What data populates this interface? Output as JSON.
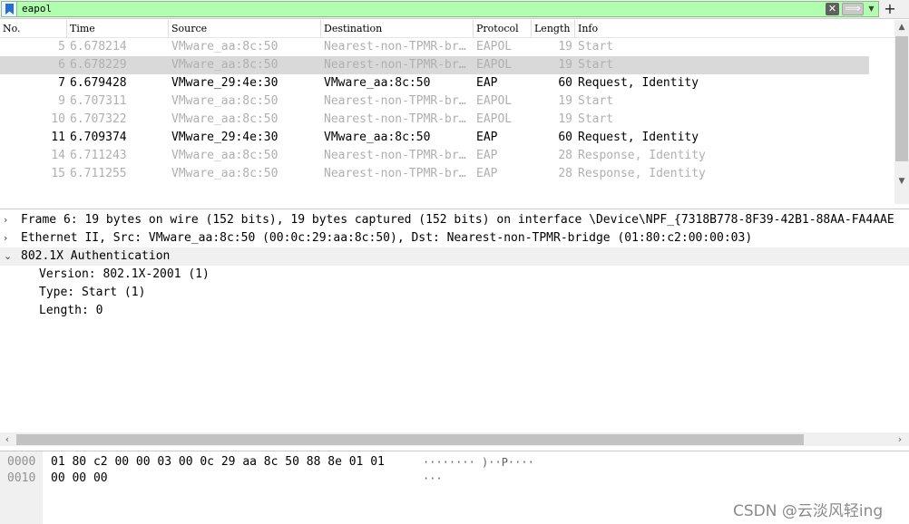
{
  "filter": {
    "value": "eapol",
    "clear_icon": "✕",
    "apply_icon": "⟹",
    "dropdown_icon": "▼",
    "add_icon": "+"
  },
  "packet_list": {
    "columns": [
      "No.",
      "Time",
      "Source",
      "Destination",
      "Protocol",
      "Length",
      "Info"
    ],
    "rows": [
      {
        "no": "5",
        "time": "6.678214",
        "src": "VMware_aa:8c:50",
        "dst": "Nearest-non-TPMR-br…",
        "proto": "EAPOL",
        "len": "19",
        "info": "Start"
      },
      {
        "no": "6",
        "time": "6.678229",
        "src": "VMware_aa:8c:50",
        "dst": "Nearest-non-TPMR-br…",
        "proto": "EAPOL",
        "len": "19",
        "info": "Start"
      },
      {
        "no": "7",
        "time": "6.679428",
        "src": "VMware_29:4e:30",
        "dst": "VMware_aa:8c:50",
        "proto": "EAP",
        "len": "60",
        "info": "Request, Identity"
      },
      {
        "no": "9",
        "time": "6.707311",
        "src": "VMware_aa:8c:50",
        "dst": "Nearest-non-TPMR-br…",
        "proto": "EAPOL",
        "len": "19",
        "info": "Start"
      },
      {
        "no": "10",
        "time": "6.707322",
        "src": "VMware_aa:8c:50",
        "dst": "Nearest-non-TPMR-br…",
        "proto": "EAPOL",
        "len": "19",
        "info": "Start"
      },
      {
        "no": "11",
        "time": "6.709374",
        "src": "VMware_29:4e:30",
        "dst": "VMware_aa:8c:50",
        "proto": "EAP",
        "len": "60",
        "info": "Request, Identity"
      },
      {
        "no": "14",
        "time": "6.711243",
        "src": "VMware_aa:8c:50",
        "dst": "Nearest-non-TPMR-br…",
        "proto": "EAP",
        "len": "28",
        "info": "Response, Identity"
      },
      {
        "no": "15",
        "time": "6.711255",
        "src": "VMware_aa:8c:50",
        "dst": "Nearest-non-TPMR-br…",
        "proto": "EAP",
        "len": "28",
        "info": "Response, Identity"
      }
    ]
  },
  "detail": {
    "frame": "Frame 6: 19 bytes on wire (152 bits), 19 bytes captured (152 bits) on interface \\Device\\NPF_{7318B778-8F39-42B1-88AA-FA4AAE",
    "ethernet": "Ethernet II, Src: VMware_aa:8c:50 (00:0c:29:aa:8c:50), Dst: Nearest-non-TPMR-bridge (01:80:c2:00:00:03)",
    "auth": "802.1X Authentication",
    "version": "Version: 802.1X-2001 (1)",
    "type": "Type: Start (1)",
    "length": "Length: 0"
  },
  "bytes": {
    "rows": [
      {
        "offset": "0000",
        "hex": "01 80 c2 00 00 03 00 0c  29 aa 8c 50 88 8e 01 01",
        "ascii": "········ )··P····"
      },
      {
        "offset": "0010",
        "hex": "00 00 00",
        "ascii": "···"
      }
    ]
  },
  "watermark": "CSDN @云淡风轻ing"
}
